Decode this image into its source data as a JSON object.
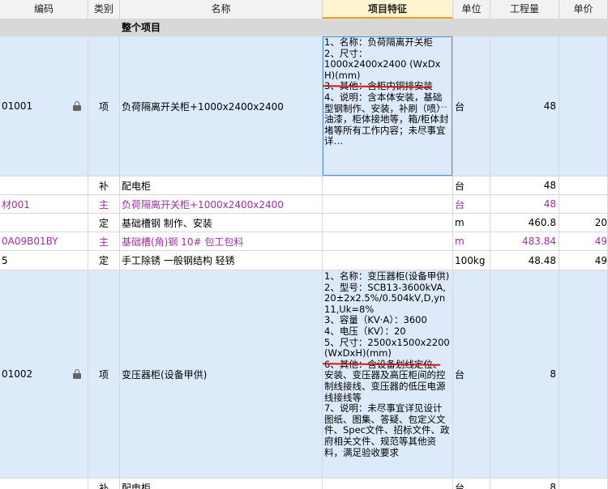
{
  "headers": {
    "code": "编码",
    "type": "类别",
    "name": "名称",
    "feature": "项目特征",
    "unit": "单位",
    "qty": "工程量",
    "price": "单价"
  },
  "group": {
    "name": "整个项目"
  },
  "rows": [
    {
      "code": "01001",
      "type": "项",
      "name": "负荷隔离开关柜+1000x2400x2400",
      "feature": "1、名称：负荷隔离开关柜\n2、尺寸：\n1000x2400x2400 (WxDxH)(mm)\n3、其他：含柜内铜排安装\n4、说明：含本体安装，基础型钢制作、安装，补刷（喷）油漆，柜体接地等，箱/柜体封堵等所有工作内容；未尽事宜详…",
      "more": "…",
      "unit": "台",
      "qty": "48",
      "price": ""
    },
    {
      "code": "",
      "type": "补",
      "name": "配电柜",
      "feature": "",
      "unit": "台",
      "qty": "48",
      "price": ""
    },
    {
      "code": "材001",
      "type": "主",
      "name": "负荷隔离开关柜+1000x2400x2400",
      "feature": "",
      "unit": "台",
      "qty": "48",
      "price": ""
    },
    {
      "code": "",
      "type": "定",
      "name": "基础槽钢 制作、安装",
      "feature": "",
      "unit": "m",
      "qty": "460.8",
      "price": "20"
    },
    {
      "code": "0A09B01BY",
      "type": "主",
      "name": "基础槽(角)钢 10# 包工包料",
      "feature": "",
      "unit": "m",
      "qty": "483.84",
      "price": "49"
    },
    {
      "code": "5",
      "type": "定",
      "name": "手工除锈 一般钢结构 轻锈",
      "feature": "",
      "unit": "100kg",
      "qty": "48.48",
      "price": "49"
    },
    {
      "code": "01002",
      "type": "项",
      "name": "变压器柜(设备甲供)",
      "feature": "1、名称：变压器柜(设备甲供)\n2、型号：SCB13-3600kVA,20±2x2.5%/0.504kV,D,yn11,Uk=8%\n3、容量（KV·A）：3600\n4、电压（KV）：20\n5、尺寸：2500x1500x2200 (WxDxH)(mm)\n6、其他：含设备划线定位、安装、变压器及高压柜间的控制线接线、变压器的低压电源线接线等\n7、说明：未尽事宜详见设计图纸、图集、答疑、包定义文件、Spec文件、招标文件、政府相关文件、规范等其他资料，满足验收要求",
      "unit": "台",
      "qty": "8",
      "price": ""
    },
    {
      "code": "",
      "type": "补",
      "name": "配电柜",
      "feature": "",
      "unit": "台",
      "qty": "8",
      "price": ""
    }
  ]
}
